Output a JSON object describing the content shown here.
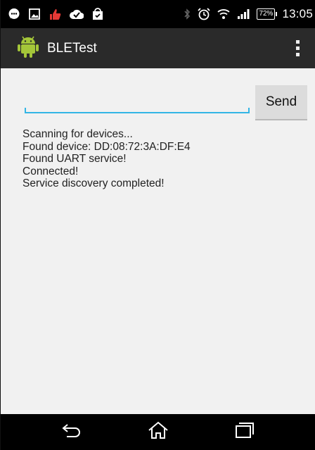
{
  "status_bar": {
    "time": "13:05",
    "battery": "72%",
    "left_icons": [
      "chat-icon",
      "image-icon",
      "thumbs-up-icon",
      "checkmark-cloud-icon",
      "shopping-bag-icon"
    ],
    "right_icons": [
      "bluetooth-icon",
      "alarm-icon",
      "wifi-icon",
      "signal-icon",
      "battery-icon"
    ]
  },
  "action_bar": {
    "title": "BLETest",
    "icon": "android-icon",
    "overflow": "overflow-menu-icon"
  },
  "composer": {
    "input_value": "",
    "input_placeholder": "",
    "send_label": "Send"
  },
  "log": {
    "lines": [
      "Scanning for devices...",
      "Found device: DD:08:72:3A:DF:E4",
      "Found UART service!",
      "Connected!",
      "Service discovery completed!"
    ]
  },
  "nav_bar": {
    "items": [
      "back-icon",
      "home-icon",
      "recent-apps-icon"
    ]
  },
  "colors": {
    "accent": "#33b5e5",
    "action_bar": "#2a2a2a",
    "content_bg": "#f1f1f1",
    "android_green": "#a4c639"
  }
}
